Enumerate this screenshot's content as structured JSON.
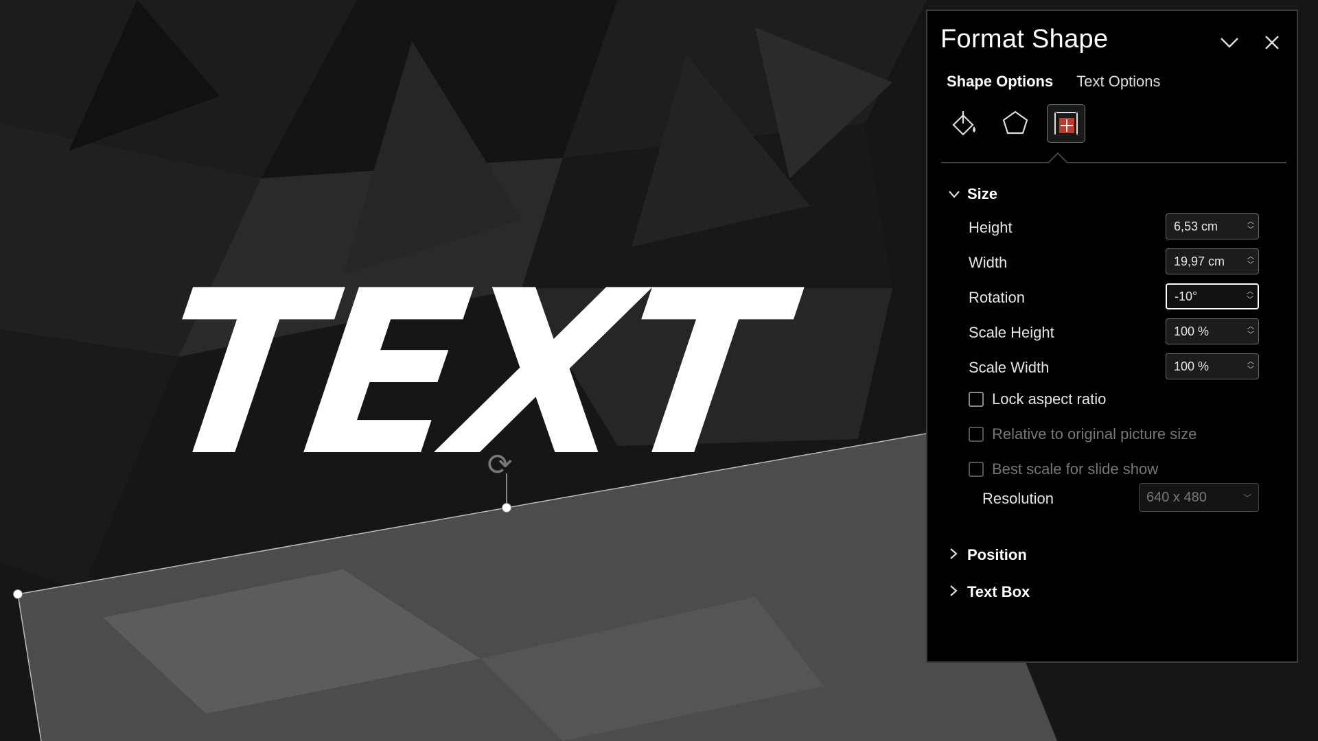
{
  "slide": {
    "text": "TEXT"
  },
  "panel": {
    "title": "Format Shape",
    "tabs": [
      {
        "label": "Shape Options",
        "active": true
      },
      {
        "label": "Text Options",
        "active": false
      }
    ],
    "icons": [
      "fill-line-icon",
      "effects-icon",
      "size-properties-icon"
    ],
    "size_section": {
      "title": "Size",
      "fields": [
        {
          "label": "Height",
          "value": "6,53 cm"
        },
        {
          "label": "Width",
          "value": "19,97 cm"
        },
        {
          "label": "Rotation",
          "value": "-10°"
        },
        {
          "label": "Scale Height",
          "value": "100 %"
        },
        {
          "label": "Scale Width",
          "value": "100 %"
        }
      ],
      "checkboxes": [
        {
          "label": "Lock aspect ratio",
          "checked": false,
          "enabled": true
        },
        {
          "label": "Relative to original picture size",
          "checked": false,
          "enabled": false
        },
        {
          "label": "Best scale for slide show",
          "checked": false,
          "enabled": false
        }
      ],
      "resolution_label": "Resolution",
      "resolution_value": "640 x 480"
    },
    "collapsed_sections": [
      "Position",
      "Text Box"
    ]
  },
  "colors": {
    "panel_bg": "#000000",
    "accent_icon": "#c0392b"
  }
}
